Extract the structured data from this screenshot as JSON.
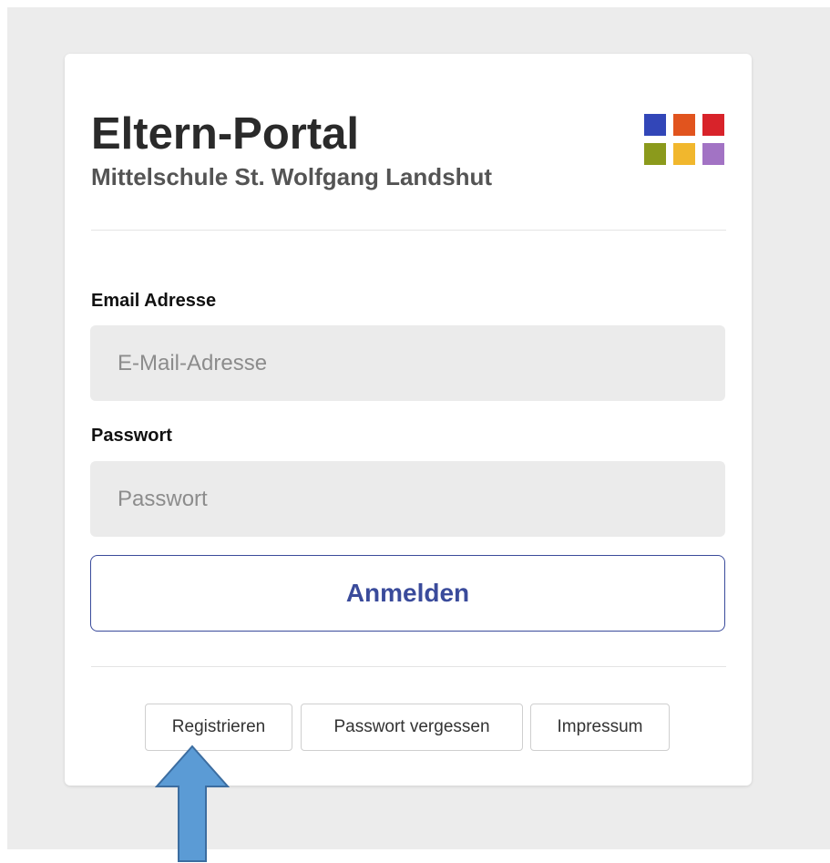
{
  "portal": {
    "title": "Eltern-Portal",
    "school_name": "Mittelschule St. Wolfgang Landshut"
  },
  "logo": {
    "name": "school-logo-icon",
    "colors": [
      "#3246b8",
      "#e1541e",
      "#d8232a",
      "#8b9a1c",
      "#f1b72d",
      "#a273c4"
    ]
  },
  "form": {
    "email_label": "Email Adresse",
    "email_placeholder": "E-Mail-Adresse",
    "email_value": "",
    "password_label": "Passwort",
    "password_placeholder": "Passwort",
    "password_value": "",
    "login_label": "Anmelden"
  },
  "footer": {
    "register_label": "Registrieren",
    "forgot_password_label": "Passwort vergessen",
    "imprint_label": "Impressum"
  },
  "annotation": {
    "icon": "up-arrow-icon",
    "target": "register-button",
    "color": "#5b9bd5",
    "border_color": "#3c6da0"
  },
  "colors": {
    "page_background": "#ececec",
    "card_background": "#ffffff",
    "accent": "#3a4b9b",
    "input_background": "#ebebeb"
  }
}
